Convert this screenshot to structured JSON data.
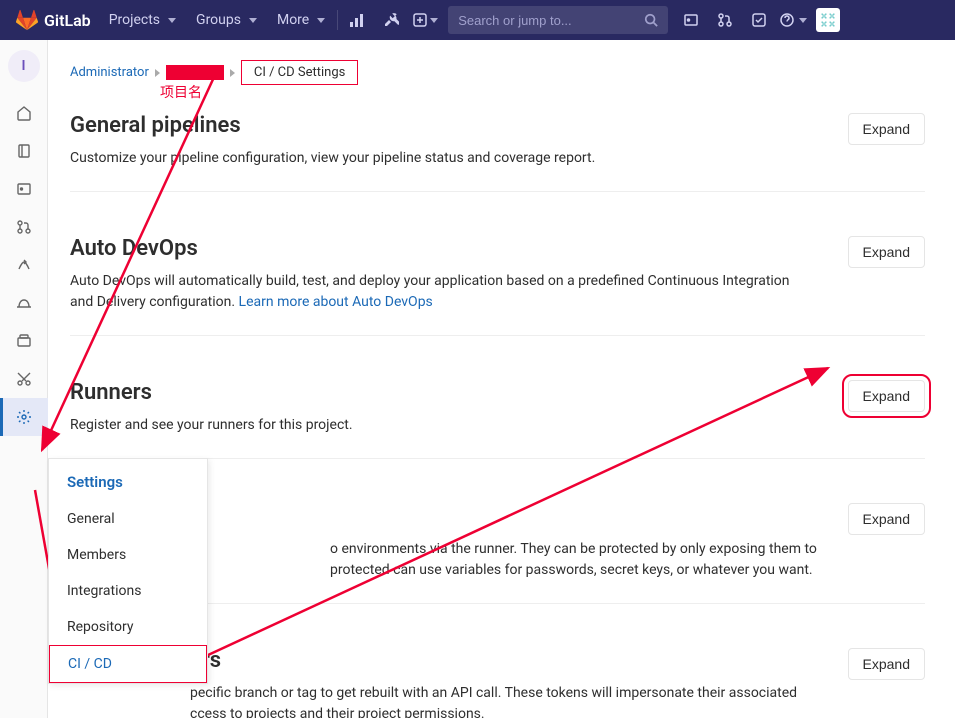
{
  "brand": "GitLab",
  "topnav": {
    "projects": "Projects",
    "groups": "Groups",
    "more": "More",
    "search_placeholder": "Search or jump to..."
  },
  "rail": {
    "project_initial": "I"
  },
  "breadcrumb": {
    "root": "Administrator",
    "current": "CI / CD Settings"
  },
  "annotation": {
    "project_name_label": "项目名"
  },
  "flyout": {
    "title": "Settings",
    "items": [
      "General",
      "Members",
      "Integrations",
      "Repository",
      "CI / CD"
    ]
  },
  "sections": [
    {
      "title": "General pipelines",
      "desc": "Customize your pipeline configuration, view your pipeline status and coverage report.",
      "expand": "Expand"
    },
    {
      "title": "Auto DevOps",
      "desc_pre": "Auto DevOps will automatically build, test, and deploy your application based on a predefined Continuous Integration and Delivery configuration. ",
      "link": "Learn more about Auto DevOps",
      "expand": "Expand"
    },
    {
      "title": "Runners",
      "desc": "Register and see your runners for this project.",
      "expand": "Expand"
    },
    {
      "title_tail": "",
      "desc": "o environments via the runner. They can be protected by only exposing them to protected can use variables for passwords, secret keys, or whatever you want.",
      "expand": "Expand"
    },
    {
      "title_tail": "ers",
      "desc": "pecific branch or tag to get rebuilt with an API call. These tokens will impersonate their associated ccess to projects and their project permissions.",
      "expand": "Expand"
    }
  ]
}
